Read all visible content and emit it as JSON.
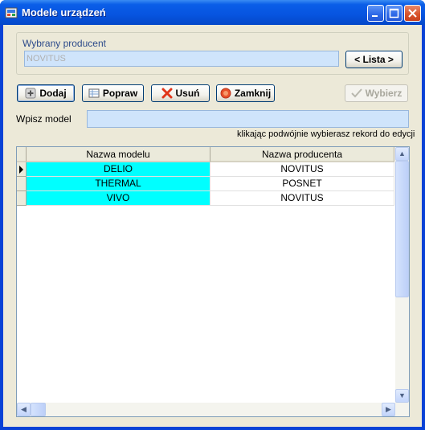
{
  "window": {
    "title": "Modele urządzeń"
  },
  "producer": {
    "group_label": "Wybrany producent",
    "value": "NOVITUS",
    "list_button": "< Lista >"
  },
  "toolbar": {
    "add": "Dodaj",
    "edit": "Popraw",
    "delete": "Usuń",
    "close": "Zamknij",
    "select": "Wybierz"
  },
  "search": {
    "label": "Wpisz model",
    "value": "",
    "hint": "klikając podwójnie wybierasz rekord do edycji"
  },
  "grid": {
    "headers": [
      "Nazwa modelu",
      "Nazwa producenta"
    ],
    "rows": [
      {
        "model": "DELIO",
        "producer": "NOVITUS"
      },
      {
        "model": "THERMAL",
        "producer": "POSNET"
      },
      {
        "model": "VIVO",
        "producer": "NOVITUS"
      }
    ],
    "selected_row": 0
  },
  "colors": {
    "selected_model_cell": "#00ffff",
    "titlebar": "#0754e0",
    "dialog_bg": "#ece9d8"
  }
}
